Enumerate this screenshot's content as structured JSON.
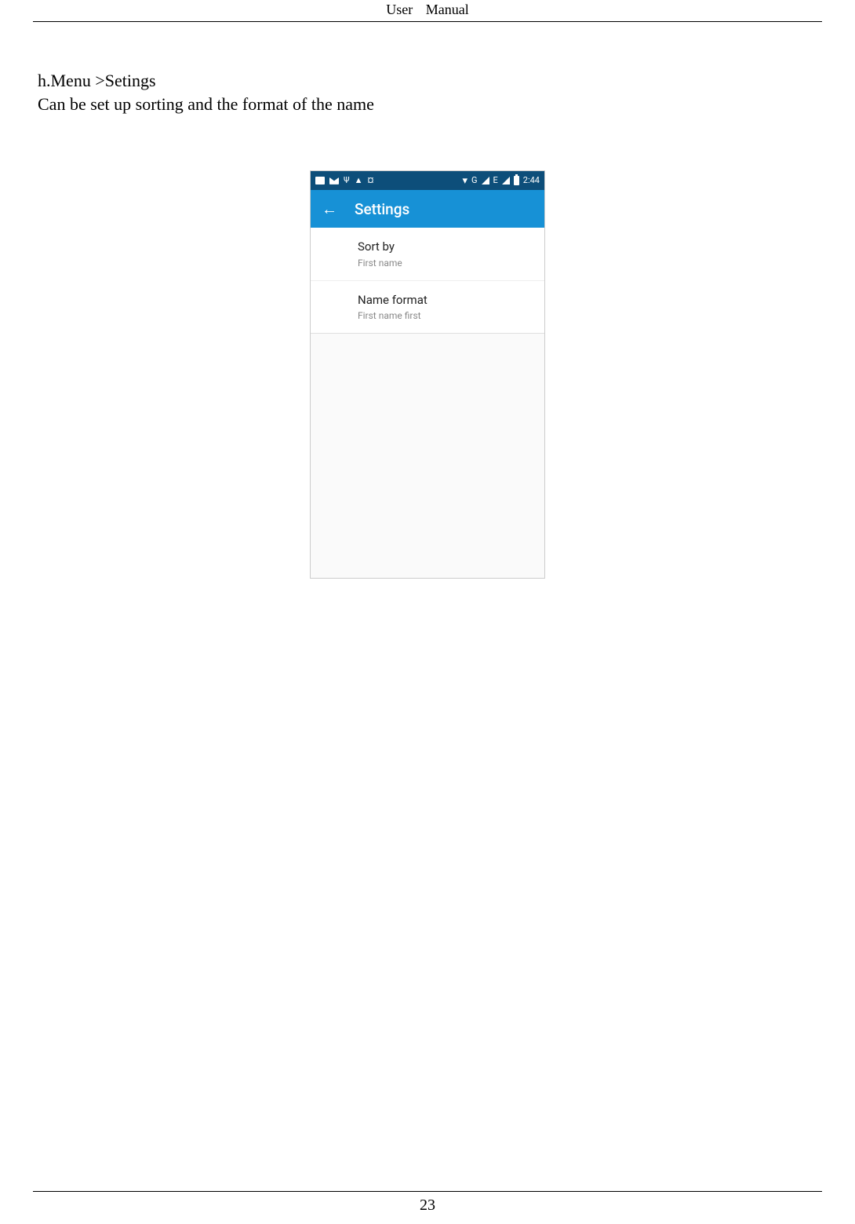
{
  "document": {
    "header_left": "User",
    "header_right": "Manual",
    "page_number": "23",
    "section_heading": "h.Menu >Setings",
    "section_text": "Can be set up sorting and the format of the name"
  },
  "screenshot": {
    "status_bar": {
      "time": "2:44",
      "network_g": "G",
      "network_e": "E"
    },
    "app_bar": {
      "title": "Settings"
    },
    "settings": [
      {
        "title": "Sort by",
        "value": "First name"
      },
      {
        "title": "Name format",
        "value": "First name first"
      }
    ]
  }
}
